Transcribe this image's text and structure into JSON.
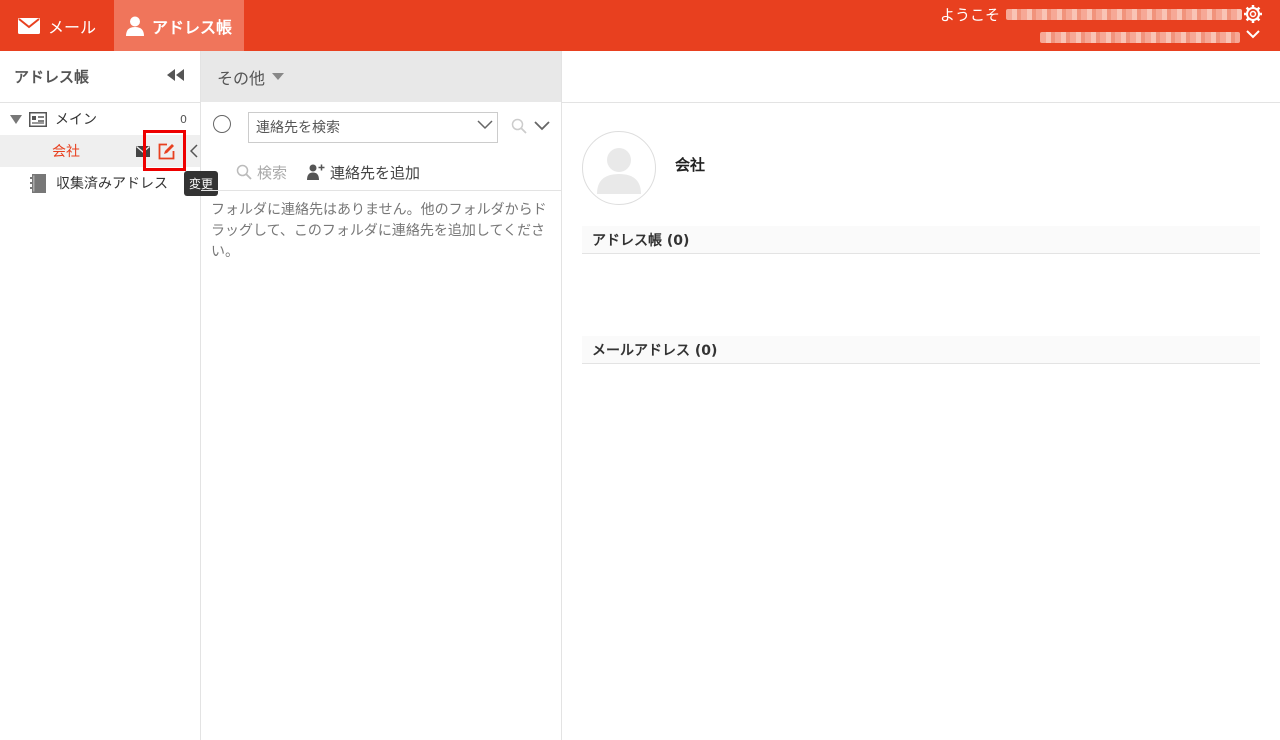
{
  "topbar": {
    "mail_tab": "メール",
    "addressbook_tab": "アドレス帳",
    "welcome": "ようこそ"
  },
  "sidebar": {
    "title": "アドレス帳",
    "tree": {
      "main": {
        "label": "メイン",
        "count": "0"
      },
      "company": {
        "label": "会社"
      },
      "collected": {
        "label": "収集済みアドレス"
      }
    },
    "tooltip": "変更"
  },
  "middle": {
    "folder_dropdown": "その他",
    "search_placeholder": "連絡先を検索",
    "search_button": "検索",
    "add_contact": "連絡先を追加",
    "empty_message": "フォルダに連絡先はありません。他のフォルダからドラッグして、このフォルダに連絡先を追加してください。"
  },
  "detail": {
    "name": "会社",
    "section_addressbook": "アドレス帳 (0)",
    "section_email": "メールアドレス (0)"
  },
  "colors": {
    "brand": "#e8401f",
    "active_tab": "#f0755b",
    "highlight_box": "#e00000"
  }
}
